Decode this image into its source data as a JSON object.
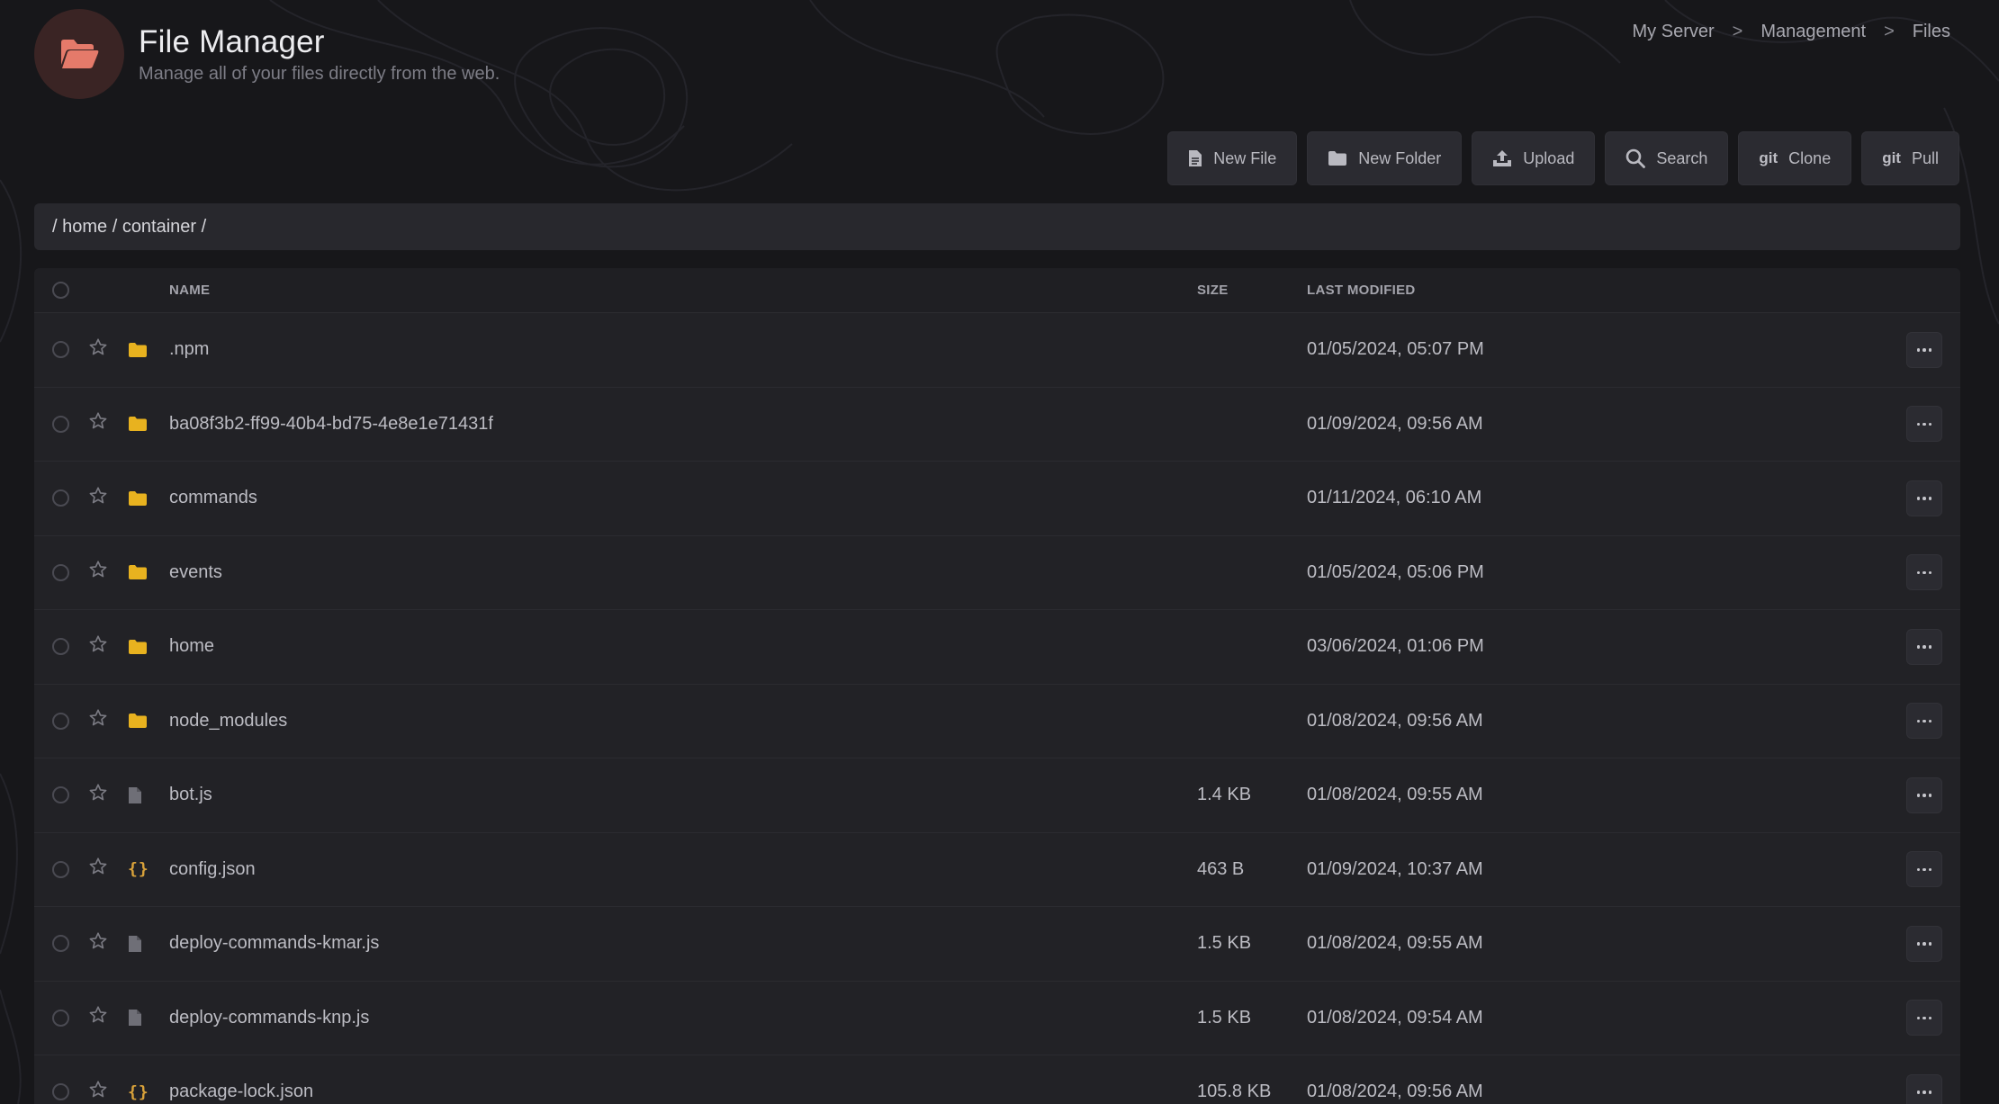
{
  "header": {
    "title": "File Manager",
    "subtitle": "Manage all of your files directly from the web."
  },
  "breadcrumb": [
    "My Server",
    "Management",
    "Files"
  ],
  "breadcrumb_separator": ">",
  "toolbar": {
    "new_file": "New File",
    "new_folder": "New Folder",
    "upload": "Upload",
    "search": "Search",
    "clone_prefix": "git",
    "clone": "Clone",
    "pull_prefix": "git",
    "pull": "Pull"
  },
  "path": "/ home / container /",
  "table": {
    "columns": {
      "name": "NAME",
      "size": "SIZE",
      "modified": "LAST MODIFIED"
    },
    "rows": [
      {
        "name": ".npm",
        "type": "folder",
        "size": "",
        "modified": "01/05/2024, 05:07 PM"
      },
      {
        "name": "ba08f3b2-ff99-40b4-bd75-4e8e1e71431f",
        "type": "folder",
        "size": "",
        "modified": "01/09/2024, 09:56 AM"
      },
      {
        "name": "commands",
        "type": "folder",
        "size": "",
        "modified": "01/11/2024, 06:10 AM"
      },
      {
        "name": "events",
        "type": "folder",
        "size": "",
        "modified": "01/05/2024, 05:06 PM"
      },
      {
        "name": "home",
        "type": "folder",
        "size": "",
        "modified": "03/06/2024, 01:06 PM"
      },
      {
        "name": "node_modules",
        "type": "folder",
        "size": "",
        "modified": "01/08/2024, 09:56 AM"
      },
      {
        "name": "bot.js",
        "type": "file",
        "size": "1.4 KB",
        "modified": "01/08/2024, 09:55 AM"
      },
      {
        "name": "config.json",
        "type": "json",
        "size": "463 B",
        "modified": "01/09/2024, 10:37 AM"
      },
      {
        "name": "deploy-commands-kmar.js",
        "type": "file",
        "size": "1.5 KB",
        "modified": "01/08/2024, 09:55 AM"
      },
      {
        "name": "deploy-commands-knp.js",
        "type": "file",
        "size": "1.5 KB",
        "modified": "01/08/2024, 09:54 AM"
      },
      {
        "name": "package-lock.json",
        "type": "json",
        "size": "105.8 KB",
        "modified": "01/08/2024, 09:56 AM"
      }
    ]
  },
  "colors": {
    "background": "#17171a",
    "panel": "#222226",
    "folder": "#e8b21f",
    "json_icon": "#d9a23a",
    "logo_bg": "#3a2424",
    "logo_icon": "#e57a6a"
  },
  "icons": {
    "logo": "folder-open-icon",
    "new_file": "file-icon",
    "new_folder": "folder-icon",
    "upload": "upload-icon",
    "search": "search-icon",
    "row_star": "star-icon",
    "row_menu": "more-horizontal-icon"
  }
}
